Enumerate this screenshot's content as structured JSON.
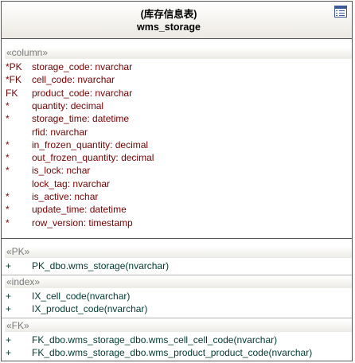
{
  "entity": {
    "title": "(库存信息表)",
    "name": "wms_storage",
    "icon": "table-icon"
  },
  "columns": {
    "stereotype": "«column»",
    "items": [
      {
        "marker": "*PK",
        "text": "storage_code:  nvarchar"
      },
      {
        "marker": "*FK",
        "text": "cell_code:  nvarchar"
      },
      {
        "marker": " FK",
        "text": "product_code:  nvarchar"
      },
      {
        "marker": "*",
        "text": "quantity:  decimal"
      },
      {
        "marker": "*",
        "text": "storage_time:  datetime"
      },
      {
        "marker": "",
        "text": "rfid:  nvarchar"
      },
      {
        "marker": "*",
        "text": "in_frozen_quantity:  decimal"
      },
      {
        "marker": "*",
        "text": "out_frozen_quantity:  decimal"
      },
      {
        "marker": "*",
        "text": "is_lock:  nchar"
      },
      {
        "marker": "",
        "text": "lock_tag:  nvarchar"
      },
      {
        "marker": "*",
        "text": "is_active:  nchar"
      },
      {
        "marker": "*",
        "text": "update_time:  datetime"
      },
      {
        "marker": "*",
        "text": "row_version:  timestamp"
      }
    ]
  },
  "pk": {
    "stereotype": "«PK»",
    "items": [
      {
        "marker": "+",
        "text": "PK_dbo.wms_storage(nvarchar)"
      }
    ]
  },
  "index": {
    "stereotype": "«index»",
    "items": [
      {
        "marker": "+",
        "text": "IX_cell_code(nvarchar)"
      },
      {
        "marker": "+",
        "text": "IX_product_code(nvarchar)"
      }
    ]
  },
  "fk": {
    "stereotype": "«FK»",
    "items": [
      {
        "marker": "+",
        "text": "FK_dbo.wms_storage_dbo.wms_cell_cell_code(nvarchar)"
      },
      {
        "marker": "+",
        "text": "FK_dbo.wms_storage_dbo.wms_product_product_code(nvarchar)"
      }
    ]
  },
  "colors": {
    "column_text": "#7a0000",
    "operation_text": "#003b30",
    "stereotype_text": "#7a7a7a",
    "border": "#555555"
  }
}
